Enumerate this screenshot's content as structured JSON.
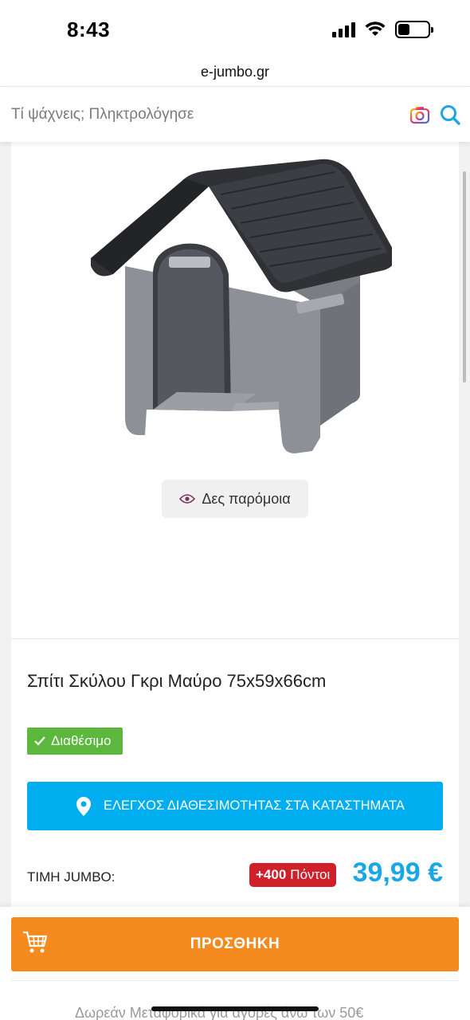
{
  "status": {
    "time": "8:43"
  },
  "browser": {
    "url": "e-jumbo.gr"
  },
  "search": {
    "placeholder": "Τί ψάχνεις; Πληκτρολόγησε"
  },
  "product": {
    "similar_label": "Δες παρόμοια",
    "title": "Σπίτι Σκύλου Γκρι Μαύρο 75x59x66cm",
    "availability": "Διαθέσιμο",
    "store_check_label": "ΕΛΕΓΧΟΣ ΔΙΑΘΕΣΙΜΟΤΗΤΑΣ ΣΤΑ ΚΑΤΑΣΤΗΜΑΤΑ",
    "price_label": "ΤΙΜΗ JUMBO:",
    "points_value": "+400",
    "points_unit": "Πόντοι",
    "price": "39,99 €"
  },
  "cart": {
    "add_label": "ΠΡΟΣΘΗΚΗ",
    "shipping_info": "Δωρεάν Μεταφορικά για αγορές άνω των 50€"
  },
  "colors": {
    "accent_blue": "#00aef0",
    "add_orange": "#f58b1f",
    "available_green": "#5cb83c",
    "points_red": "#d0202a"
  },
  "icons": [
    "signal-icon",
    "wifi-icon",
    "battery-icon",
    "camera-icon",
    "search-icon",
    "eye-icon",
    "check-icon",
    "location-pin-icon",
    "cart-icon"
  ]
}
